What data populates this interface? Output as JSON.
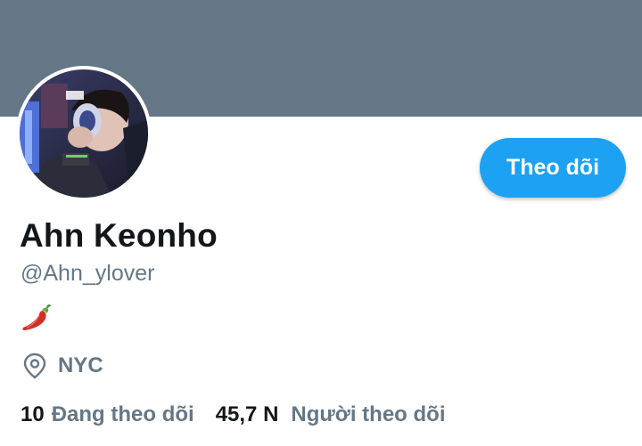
{
  "profile": {
    "display_name": "Ahn Keonho",
    "handle": "@Ahn_ylover",
    "bio_emoji": "hot-pepper-icon",
    "location": "NYC",
    "follow_button_label": "Theo dõi"
  },
  "stats": {
    "following_count": "10",
    "following_label": "Đang theo dõi",
    "followers_count": "45,7 N",
    "followers_label": "Người theo dõi"
  },
  "colors": {
    "banner": "#657786",
    "accent": "#1da1f2",
    "text_primary": "#14171a",
    "text_secondary": "#657786"
  },
  "icons": {
    "location": "location-pin-icon",
    "bio": "hot-pepper-icon"
  }
}
